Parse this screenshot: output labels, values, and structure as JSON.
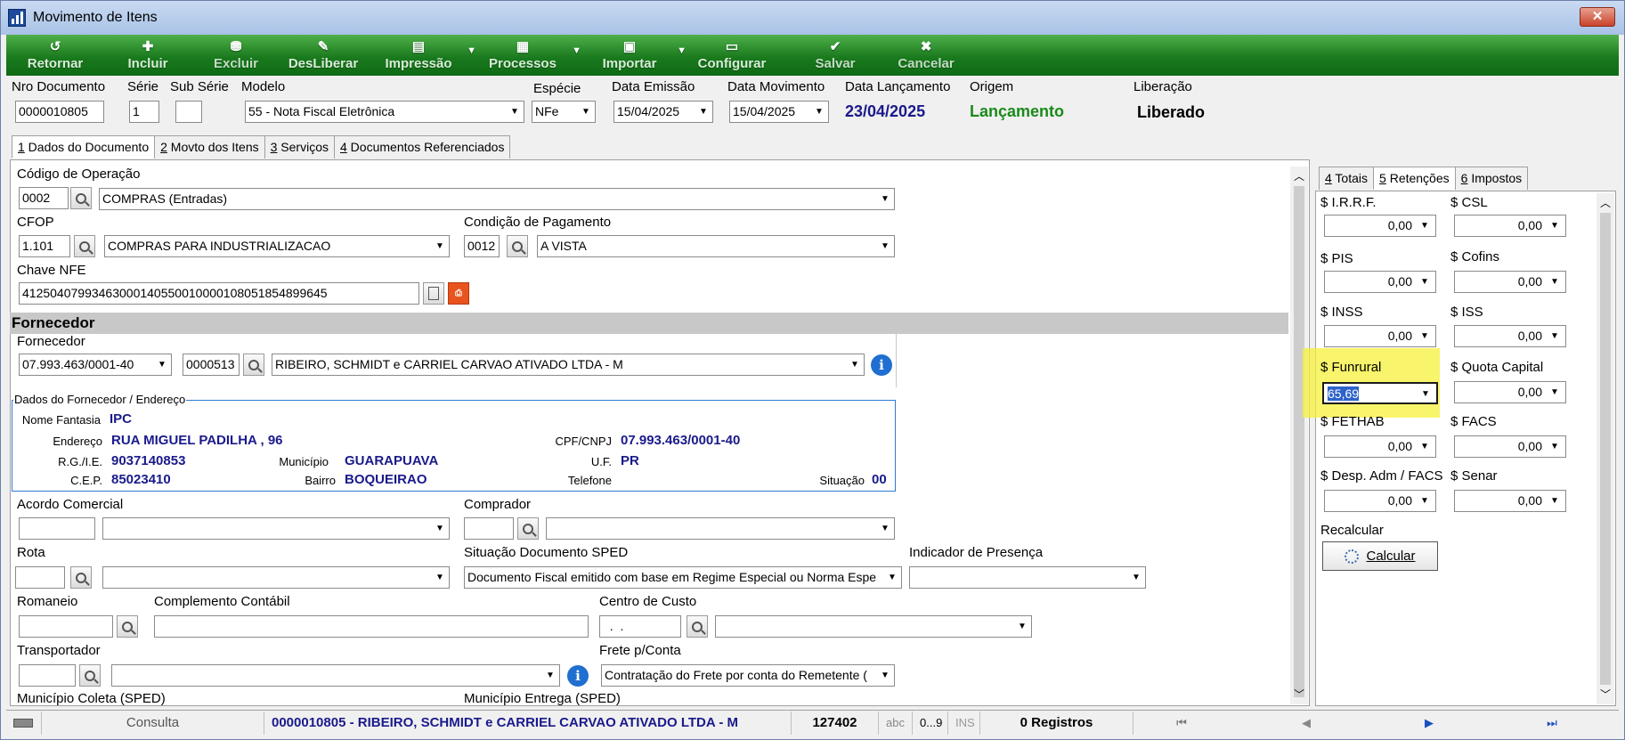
{
  "window": {
    "title": "Movimento de Itens",
    "close": "✕"
  },
  "toolbar": [
    {
      "label": "Retornar",
      "icon": "return-icon"
    },
    {
      "label": "Incluir",
      "icon": "add-icon"
    },
    {
      "label": "Excluir",
      "icon": "delete-icon"
    },
    {
      "label": "DesLiberar",
      "icon": "unrelease-icon"
    },
    {
      "label": "Impressão",
      "icon": "print-icon"
    },
    {
      "label": "Processos",
      "icon": "process-icon"
    },
    {
      "label": "Importar",
      "icon": "import-icon"
    },
    {
      "label": "Configurar",
      "icon": "config-icon"
    },
    {
      "label": "Salvar",
      "icon": "check-icon"
    },
    {
      "label": "Cancelar",
      "icon": "cancel-icon"
    }
  ],
  "header": {
    "nro_documento": {
      "label": "Nro Documento",
      "value": "0000010805"
    },
    "serie": {
      "label": "Série",
      "value": "1"
    },
    "sub_serie": {
      "label": "Sub Série",
      "value": ""
    },
    "modelo": {
      "label": "Modelo",
      "value": "55 - Nota Fiscal Eletrônica"
    },
    "especie": {
      "label": "Espécie",
      "value": "NFe"
    },
    "data_emissao": {
      "label": "Data Emissão",
      "value": "15/04/2025"
    },
    "data_movimento": {
      "label": "Data Movimento",
      "value": "15/04/2025"
    },
    "data_lancamento": {
      "label": "Data Lançamento",
      "value": "23/04/2025"
    },
    "origem": {
      "label": "Origem",
      "value": "Lançamento"
    },
    "liberacao": {
      "label": "Liberação",
      "value": "Liberado"
    }
  },
  "main_tabs": [
    {
      "key": "1",
      "label": " Dados do Documento"
    },
    {
      "key": "2",
      "label": " Movto dos Itens"
    },
    {
      "key": "3",
      "label": " Serviços"
    },
    {
      "key": "4",
      "label": " Documentos Referenciados"
    }
  ],
  "doc": {
    "codigo_operacao": {
      "label": "Código de Operação",
      "code": "0002",
      "desc": "COMPRAS (Entradas)"
    },
    "cfop": {
      "label": "CFOP",
      "code": "1.101",
      "desc": "COMPRAS PARA INDUSTRIALIZACAO"
    },
    "condicao_pagamento": {
      "label": "Condição de Pagamento",
      "code": "0012",
      "desc": "A VISTA"
    },
    "chave_nfe": {
      "label": "Chave NFE",
      "value": "41250407993463000140550010000108051854899645"
    },
    "fornecedor_section": "Fornecedor",
    "fornecedor": {
      "label": "Fornecedor",
      "cnpj": "07.993.463/0001-40",
      "code": "0000513",
      "name": "RIBEIRO, SCHMIDT e CARRIEL CARVAO ATIVADO LTDA - M"
    },
    "dados_legend": "Dados do Fornecedor / Endereço",
    "dados": {
      "nome_fantasia_l": "Nome Fantasia",
      "nome_fantasia": "IPC",
      "endereco_l": "Endereço",
      "endereco": "RUA MIGUEL PADILHA , 96",
      "cpf_cnpj_l": "CPF/CNPJ",
      "cpf_cnpj": "07.993.463/0001-40",
      "rg_ie_l": "R.G./I.E.",
      "rg_ie": "9037140853",
      "municipio_l": "Município",
      "municipio": "GUARAPUAVA",
      "uf_l": "U.F.",
      "uf": "PR",
      "cep_l": "C.E.P.",
      "cep": "85023410",
      "bairro_l": "Bairro",
      "bairro": "BOQUEIRAO",
      "telefone_l": "Telefone",
      "telefone": "",
      "situacao_l": "Situação",
      "situacao": "00"
    },
    "acordo_comercial": {
      "label": "Acordo Comercial"
    },
    "comprador": {
      "label": "Comprador"
    },
    "rota": {
      "label": "Rota"
    },
    "situacao_sped": {
      "label": "Situação Documento SPED",
      "value": "Documento Fiscal emitido com base em Regime Especial ou Norma Espe"
    },
    "indicador_presenca": {
      "label": "Indicador de Presença",
      "value": ""
    },
    "romaneio": {
      "label": "Romaneio"
    },
    "complemento_contabil": {
      "label": "Complemento Contábil"
    },
    "centro_custo": {
      "label": "Centro de Custo",
      "value": "  .  ."
    },
    "transportador": {
      "label": "Transportador"
    },
    "frete": {
      "label": "Frete p/Conta",
      "value": "Contratação do Frete por conta do Remetente ("
    },
    "municipio_coleta": {
      "label": "Município Coleta (SPED)"
    },
    "municipio_entrega": {
      "label": "Município Entrega (SPED)"
    }
  },
  "side_tabs": [
    {
      "key": "4",
      "label": " Totais"
    },
    {
      "key": "5",
      "label": " Retenções"
    },
    {
      "key": "6",
      "label": " Impostos"
    }
  ],
  "retencoes": [
    {
      "label": "$ I.R.R.F.",
      "value": "0,00"
    },
    {
      "label": "$ CSL",
      "value": "0,00"
    },
    {
      "label": "$ PIS",
      "value": "0,00"
    },
    {
      "label": "$ Cofins",
      "value": "0,00"
    },
    {
      "label": "$ INSS",
      "value": "0,00"
    },
    {
      "label": "$ ISS",
      "value": "0,00"
    },
    {
      "label": "$ Funrural",
      "value": "65,69"
    },
    {
      "label": "$ Quota Capital",
      "value": "0,00"
    },
    {
      "label": "$ FETHAB",
      "value": "0,00"
    },
    {
      "label": "$ FACS",
      "value": "0,00"
    },
    {
      "label": "$ Desp. Adm / FACS",
      "value": "0,00"
    },
    {
      "label": "$ Senar",
      "value": "0,00"
    }
  ],
  "recalcular": "Recalcular",
  "calcular": "Calcular",
  "status": {
    "mode": "Consulta",
    "record": "0000010805 - RIBEIRO, SCHMIDT e CARRIEL CARVAO ATIVADO LTDA - M",
    "id": "127402",
    "abc": "abc",
    "num": "0...9",
    "ins": "INS",
    "registros": "0 Registros"
  },
  "colors": {
    "toolbar": "#1a7a1e",
    "origem": "#1a8a1a",
    "lancamento": "#1a1a8c",
    "highlight": "#f6f03a"
  }
}
